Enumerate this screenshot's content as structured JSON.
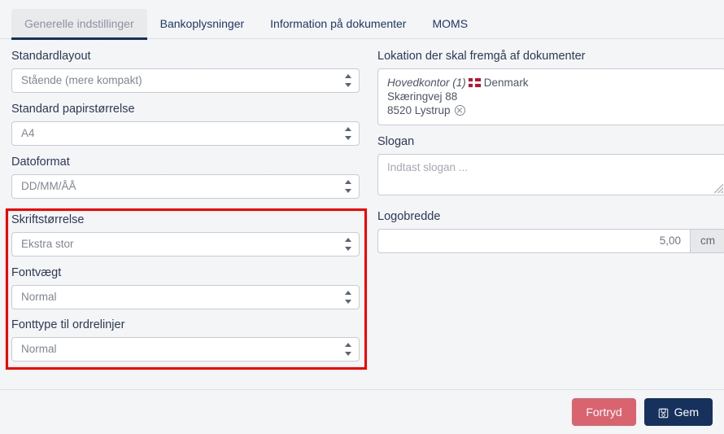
{
  "tabs": [
    {
      "label": "Generelle indstillinger",
      "active": true
    },
    {
      "label": "Bankoplysninger",
      "active": false
    },
    {
      "label": "Information på dokumenter",
      "active": false
    },
    {
      "label": "MOMS",
      "active": false
    }
  ],
  "left_column": {
    "standardlayout": {
      "label": "Standardlayout",
      "value": "Stående (mere kompakt)"
    },
    "papirstorrelse": {
      "label": "Standard papirstørrelse",
      "value": "A4"
    },
    "datoformat": {
      "label": "Datoformat",
      "value": "DD/MM/ÅÅ"
    },
    "skriftstorrelse": {
      "label": "Skriftstørrelse",
      "value": "Ekstra stor"
    },
    "fontvaegt": {
      "label": "Fontvægt",
      "value": "Normal"
    },
    "fonttype": {
      "label": "Fonttype til ordrelinjer",
      "value": "Normal"
    }
  },
  "right_column": {
    "lokation": {
      "label": "Lokation der skal fremgå af dokumenter",
      "name": "Hovedkontor (1)",
      "country": "Denmark",
      "address_line": "Skæringvej 88",
      "postal_city": "8520 Lystrup"
    },
    "slogan": {
      "label": "Slogan",
      "value": "",
      "placeholder": "Indtast slogan ..."
    },
    "logobredde": {
      "label": "Logobredde",
      "value": "5,00",
      "unit": "cm"
    }
  },
  "footer": {
    "cancel_label": "Fortryd",
    "save_label": "Gem"
  },
  "colors": {
    "accent_navy": "#16325c",
    "cancel_red": "#d9636e",
    "annotation_red": "#ff0000",
    "flag_red": "#c8102e",
    "page_background": "#f4f5f6"
  }
}
